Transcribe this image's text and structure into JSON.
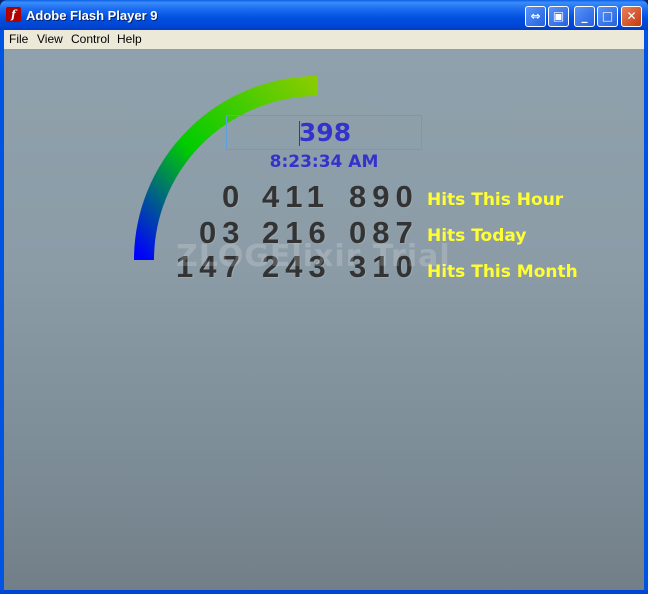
{
  "window": {
    "title": "Adobe Flash Player 9",
    "icon": "flash-icon"
  },
  "title_buttons": {
    "extra1": "⇔",
    "extra2": "▣",
    "minimize": "_",
    "maximize": "□",
    "close": "✕"
  },
  "menu": {
    "items": [
      "File",
      "View",
      "Control",
      "Help"
    ]
  },
  "counter": {
    "current_value": "398",
    "time": "8:23:34 AM",
    "rows": [
      {
        "groups": [
          "0",
          "411",
          "890"
        ],
        "label": "Hits This Hour"
      },
      {
        "groups": [
          "03",
          "216",
          "087"
        ],
        "label": "Hits Today"
      },
      {
        "groups": [
          "147",
          "243",
          "310"
        ],
        "label": "Hits This Month"
      }
    ],
    "watermark": "ZLOGElixir Trial"
  },
  "colors": {
    "arc_start": "#0000ff",
    "arc_mid": "#00cc00",
    "arc_end": "#77cc00",
    "label": "#ffff33",
    "value": "#3333cc"
  }
}
